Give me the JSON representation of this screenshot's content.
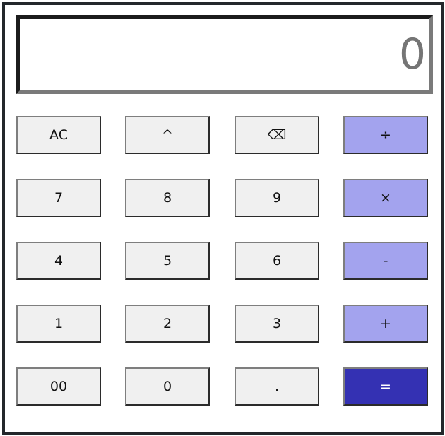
{
  "display": {
    "value": "0"
  },
  "keys": {
    "ac": "AC",
    "power": "^",
    "backspace": "⌫",
    "divide": "÷",
    "seven": "7",
    "eight": "8",
    "nine": "9",
    "multiply": "×",
    "four": "4",
    "five": "5",
    "six": "6",
    "subtract": "-",
    "one": "1",
    "two": "2",
    "three": "3",
    "add": "+",
    "double_zero": "00",
    "zero": "0",
    "decimal": ".",
    "equals": "="
  },
  "colors": {
    "operator": "#a3a3ee",
    "equals": "#3431b3",
    "number": "#f0f0f0"
  }
}
